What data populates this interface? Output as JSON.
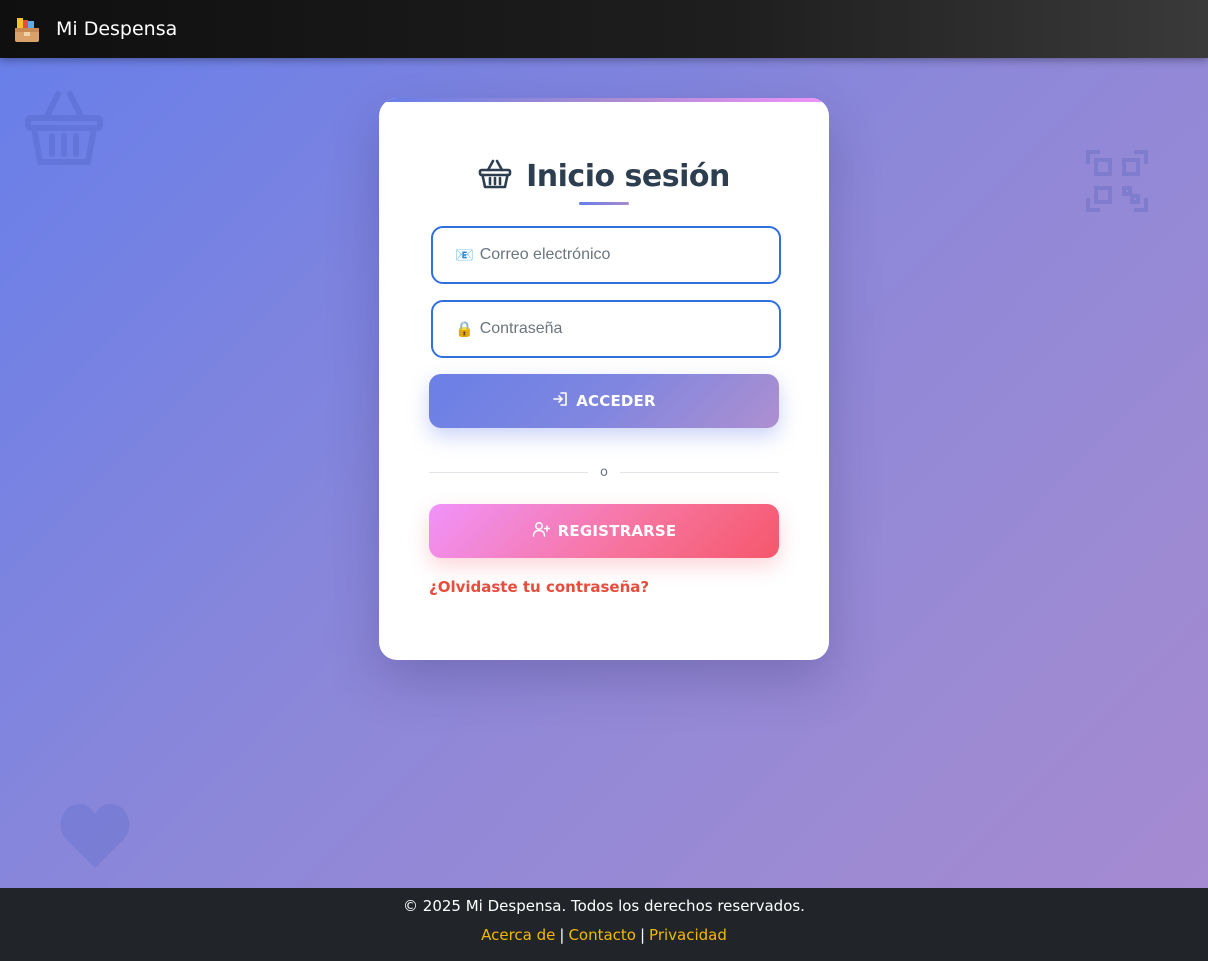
{
  "navbar": {
    "brand_title": "Mi Despensa",
    "logo_icon": "grocery-box-icon"
  },
  "background_icons": [
    "shopping-basket-icon",
    "qr-code-icon",
    "heart-icon"
  ],
  "login_card": {
    "title": "Inicio sesión",
    "title_icon": "shopping-basket-icon",
    "email": {
      "icon": "📧",
      "placeholder": "Correo electrónico",
      "value": ""
    },
    "password": {
      "icon": "🔒",
      "placeholder": "Contraseña",
      "value": ""
    },
    "login_button": {
      "label": "ACCEDER",
      "icon": "sign-in-icon"
    },
    "divider_text": "o",
    "register_button": {
      "label": "REGISTRARSE",
      "icon": "user-plus-icon"
    },
    "forgot_password_link": "¿Olvidaste tu contraseña?"
  },
  "footer": {
    "copyright": "© 2025 Mi Despensa. Todos los derechos reservados.",
    "links": {
      "about": "Acerca de",
      "contact": "Contacto",
      "privacy": "Privacidad",
      "separator": "|"
    }
  },
  "colors": {
    "accent_blue": "#667eea",
    "accent_purple": "#a78bd0",
    "danger_red": "#e74c3c",
    "footer_link": "#f5b800",
    "input_border": "#2f6fe0"
  }
}
